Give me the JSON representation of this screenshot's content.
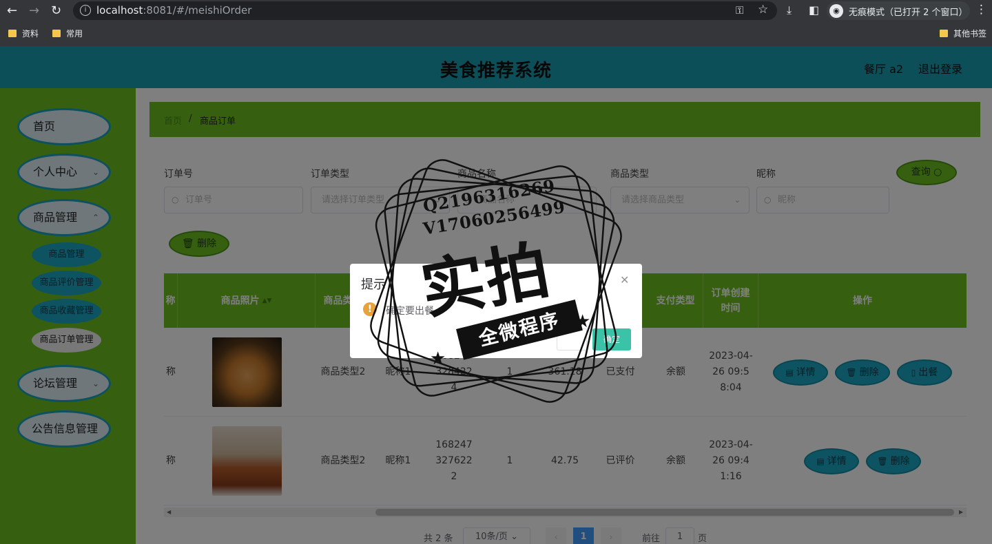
{
  "browser": {
    "url_host": "localhost",
    "url_rest": ":8081/#/meishiOrder",
    "incognito_label": "无痕模式（已打开 2 个窗口）",
    "bookmarks": [
      "资料",
      "常用"
    ],
    "other_bookmarks": "其他书签"
  },
  "header": {
    "title": "美食推荐系统",
    "user": "餐厅 a2",
    "logout": "退出登录"
  },
  "sidebar": {
    "items": [
      {
        "label": "首页"
      },
      {
        "label": "个人中心"
      },
      {
        "label": "商品管理"
      },
      {
        "label": "论坛管理"
      },
      {
        "label": "公告信息管理"
      }
    ],
    "subitems": [
      {
        "label": "商品管理"
      },
      {
        "label": "商品评价管理"
      },
      {
        "label": "商品收藏管理"
      },
      {
        "label": "商品订单管理"
      }
    ]
  },
  "breadcrumb": {
    "home": "首页",
    "separator": "/",
    "current": "商品订单"
  },
  "filters": {
    "order_no_label": "订单号",
    "order_no_placeholder": "订单号",
    "order_type_label": "订单类型",
    "order_type_placeholder": "请选择订单类型",
    "goods_name_label": "商品名称",
    "goods_name_placeholder": "商品名称",
    "goods_type_label": "商品类型",
    "goods_type_placeholder": "请选择商品类型",
    "nickname_label": "昵称",
    "nickname_placeholder": "昵称",
    "search_button": "查询",
    "delete_button": "删除"
  },
  "table": {
    "columns": [
      "称",
      "商品照片",
      "商品类型",
      "支付类型",
      "订单创建时间",
      "操作"
    ],
    "rows": [
      {
        "col0": "称",
        "goods_type": "商品类型2",
        "nickname": "昵称1",
        "order_no": "1682473284224",
        "qty": "1",
        "price": "361.18",
        "status": "已支付",
        "pay_type": "余额",
        "created": "2023-04-26 09:58:04",
        "actions": [
          "详情",
          "删除",
          "出餐"
        ]
      },
      {
        "col0": "称",
        "goods_type": "商品类型2",
        "nickname": "昵称1",
        "order_no": "1682473276222",
        "qty": "1",
        "price": "42.75",
        "status": "已评价",
        "pay_type": "余额",
        "created": "2023-04-26 09:41:16",
        "actions": [
          "详情",
          "删除"
        ]
      }
    ]
  },
  "pagination": {
    "total": "共 2 条",
    "page_size": "10条/页",
    "current_page": "1",
    "goto_label": "前往",
    "goto_value": "1",
    "goto_suffix": "页"
  },
  "dialog": {
    "title": "提示",
    "message": "确定要出餐",
    "ok": "确定"
  },
  "watermark": {
    "qq": "Q2196316269",
    "vx": "V17060256499",
    "big": "实拍",
    "banner": "全微程序"
  }
}
